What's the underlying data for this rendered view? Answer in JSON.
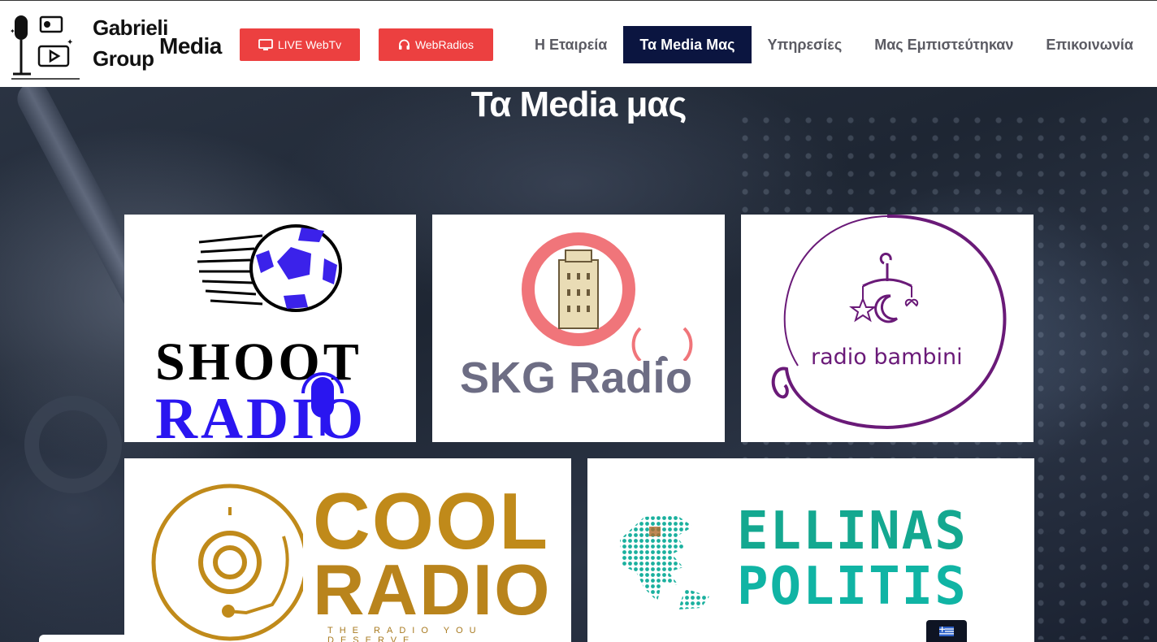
{
  "brand": {
    "line1": "Gabrieli",
    "line2": "Group",
    "line3": "Media"
  },
  "header_buttons": {
    "live_webtv": "LIVE WebTv",
    "webradios": "WebRadios"
  },
  "nav": {
    "items": [
      {
        "label": "Η Εταιρεία",
        "active": false
      },
      {
        "label": "Τα Media Μας",
        "active": true
      },
      {
        "label": "Υπηρεσίες",
        "active": false
      },
      {
        "label": "Μας Εμπιστεύτηκαν",
        "active": false
      },
      {
        "label": "Επικοινωνία",
        "active": false
      }
    ]
  },
  "section": {
    "title": "Τα Media μας"
  },
  "media": {
    "shoot_radio": {
      "line1": "SHOOT",
      "line2": "RADIO"
    },
    "skg_radio": {
      "label": "SKG Radio"
    },
    "radio_bambini": {
      "label": "radio bambini"
    },
    "cool_radio": {
      "line1": "COOL",
      "line2": "RADIO",
      "tagline": "THE RADIO YOU DESERVE"
    },
    "ellinas_politis": {
      "line1": "ELLINAS",
      "line2": "POLITIS"
    }
  },
  "colors": {
    "accent_red": "#ec4040",
    "nav_active_bg": "#0b1540",
    "nav_text": "#5b5b63"
  }
}
